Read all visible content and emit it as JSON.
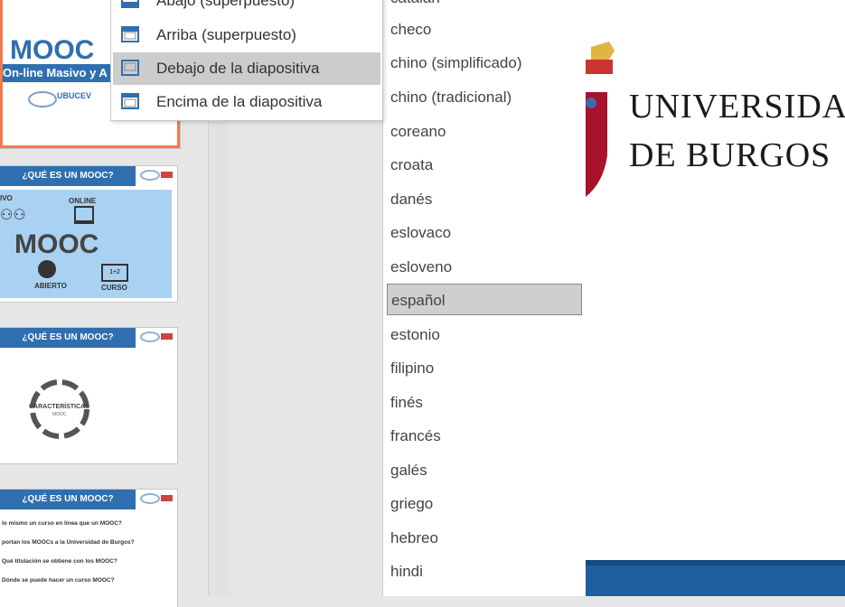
{
  "menu": {
    "items": [
      {
        "label": "Abajo (superpuesto)"
      },
      {
        "label": "Arriba (superpuesto)"
      },
      {
        "label": "Debajo de la diapositiva"
      },
      {
        "label": "Encima de la diapositiva"
      }
    ],
    "highlighted_index": 2
  },
  "languages": {
    "items": [
      "catalán",
      "checo",
      "chino (simplificado)",
      "chino (tradicional)",
      "coreano",
      "croata",
      "danés",
      "eslovaco",
      "esloveno",
      "español",
      "estonio",
      "filipino",
      "finés",
      "francés",
      "galés",
      "griego",
      "hebreo",
      "hindi"
    ],
    "selected": "español"
  },
  "slide1": {
    "title": "MOOC",
    "subtitle": "On-line Masivo y A",
    "logo_text": "UBUCEV"
  },
  "slide2": {
    "header": "¿QUÉ ES UN MOOC?",
    "center": "MOOC",
    "labels": {
      "left": "IVO",
      "online": "ONLINE",
      "abierto": "ABIERTO",
      "curso": "CURSO"
    }
  },
  "slide3": {
    "header": "¿QUÉ ES UN MOOC?",
    "center": "CARACTERÍSTICAS",
    "center_sub": "MOOC"
  },
  "slide4": {
    "header": "¿QUÉ ES UN MOOC?",
    "lines": [
      "lo mismo un curso en línea que un MOOC?",
      "portan los MOOCs a la Universidad de Burgos?",
      "Qué titulación se obtiene con los MOOC?",
      "Dónde se puede hacer un curso MOOC?"
    ]
  },
  "main_slide": {
    "line1": "UNIVERSIDA",
    "line2": "DE BURGOS"
  },
  "colors": {
    "accent_orange": "#f07a4e",
    "brand_blue": "#2f6faf",
    "highlight_gray": "#cccccc"
  }
}
